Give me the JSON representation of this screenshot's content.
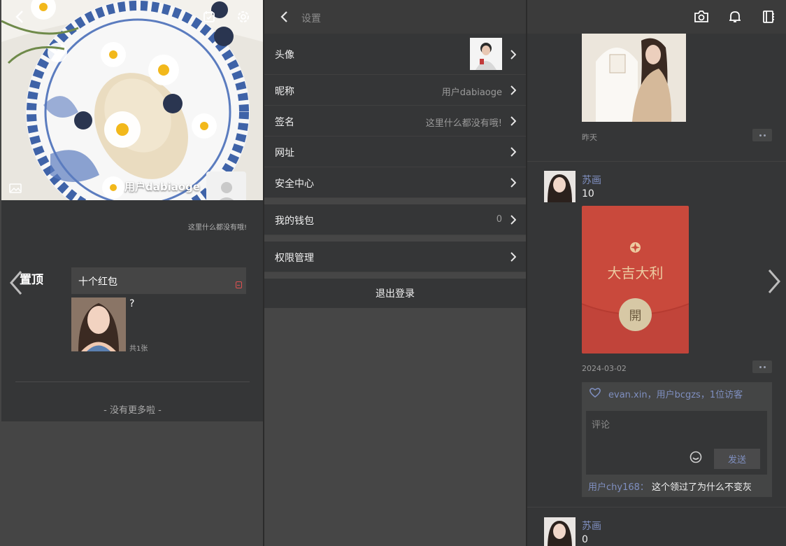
{
  "profile": {
    "username": "用户dabiaoge",
    "signature": "这里什么都没有哦!",
    "pinned_label": "置顶",
    "post": {
      "title": "十个红包",
      "text": "?",
      "photo_count": "共1张"
    },
    "no_more": "- 没有更多啦 -"
  },
  "settings": {
    "title": "设置",
    "rows": [
      {
        "label": "头像",
        "value": ""
      },
      {
        "label": "昵称",
        "value": "用户dabiaoge"
      },
      {
        "label": "签名",
        "value": "这里什么都没有哦!"
      },
      {
        "label": "网址",
        "value": ""
      },
      {
        "label": "安全中心",
        "value": ""
      },
      {
        "label": "我的钱包",
        "value": "0"
      },
      {
        "label": "权限管理",
        "value": ""
      }
    ],
    "logout": "退出登录"
  },
  "feed": {
    "first_time": "昨天",
    "post2": {
      "author": "苏画",
      "text": "10",
      "redpack_title": "大吉大利",
      "redpack_open": "開",
      "time": "2024-03-02",
      "likes": "evan.xin，用户bcgzs，1位访客",
      "comment_placeholder": "评论",
      "send_label": "发送",
      "comment_user": "用户chy168：",
      "comment_text": "这个领过了为什么不变灰"
    },
    "post3": {
      "author": "苏画",
      "text": "0"
    }
  },
  "colors": {
    "link": "#7f8fc0",
    "redpack": "#c9493c",
    "panel_bg": "#353637"
  }
}
